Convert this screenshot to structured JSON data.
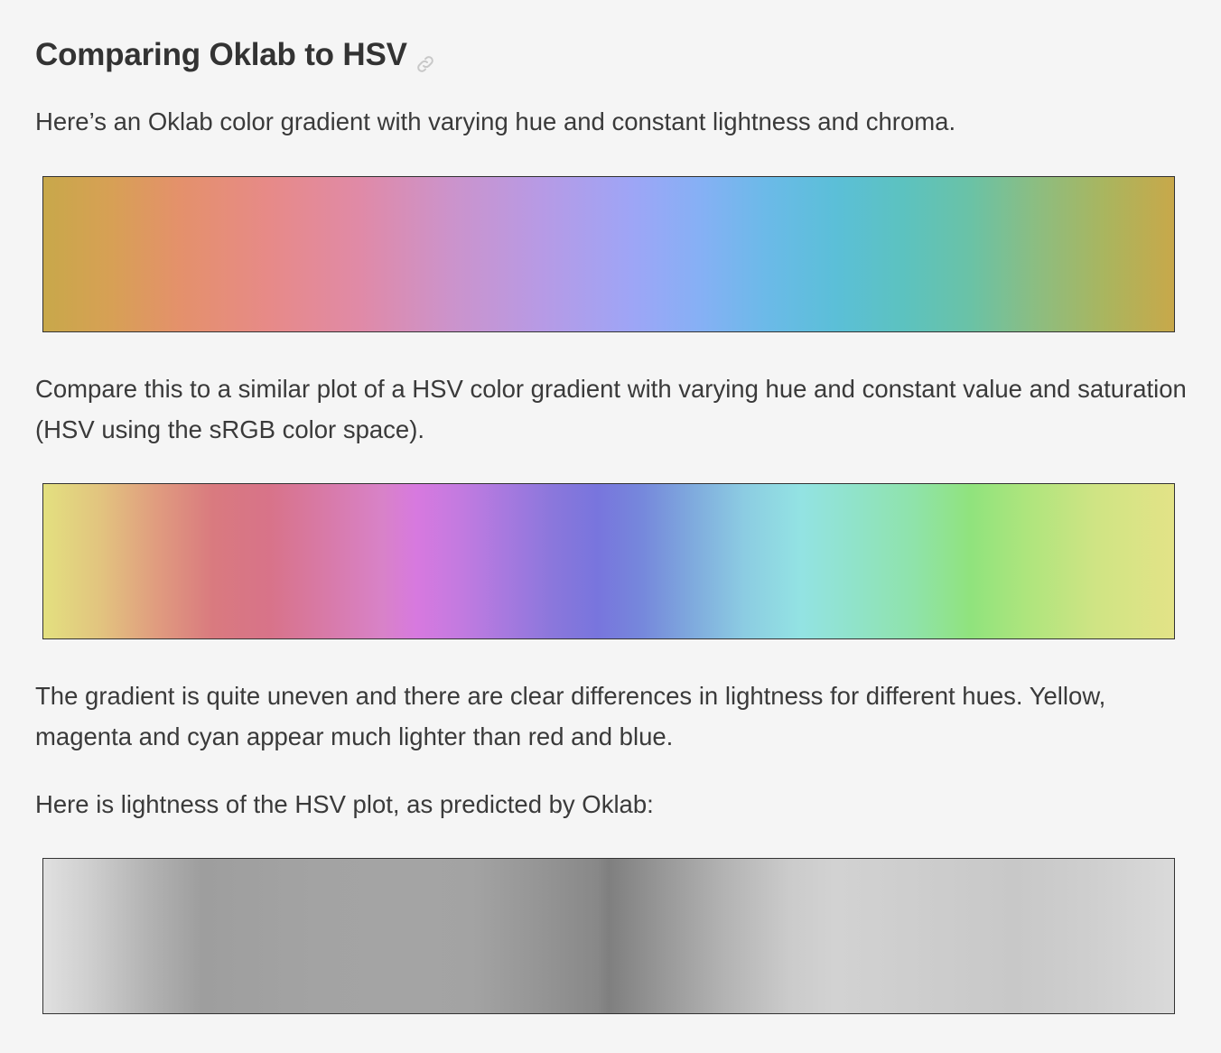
{
  "section": {
    "title": "Comparing Oklab to HSV",
    "anchor_icon": "link-icon"
  },
  "paragraphs": {
    "oklab_intro": "Here’s an Oklab color gradient with varying hue and constant lightness and chroma.",
    "hsv_compare": "Compare this to a similar plot of a HSV color gradient with varying hue and constant value and saturation (HSV using the sRGB color space).",
    "uneven": "The gradient is quite uneven and there are clear differences in lightness for different hues. Yellow, magenta and cyan appear much lighter than red and blue.",
    "lightness_intro": "Here is lightness of the HSV plot, as predicted by Oklab:"
  },
  "colors": {
    "background": "#f5f5f5",
    "text": "#333333",
    "strip_border": "#333333",
    "link_icon": "#c8c8c8"
  }
}
